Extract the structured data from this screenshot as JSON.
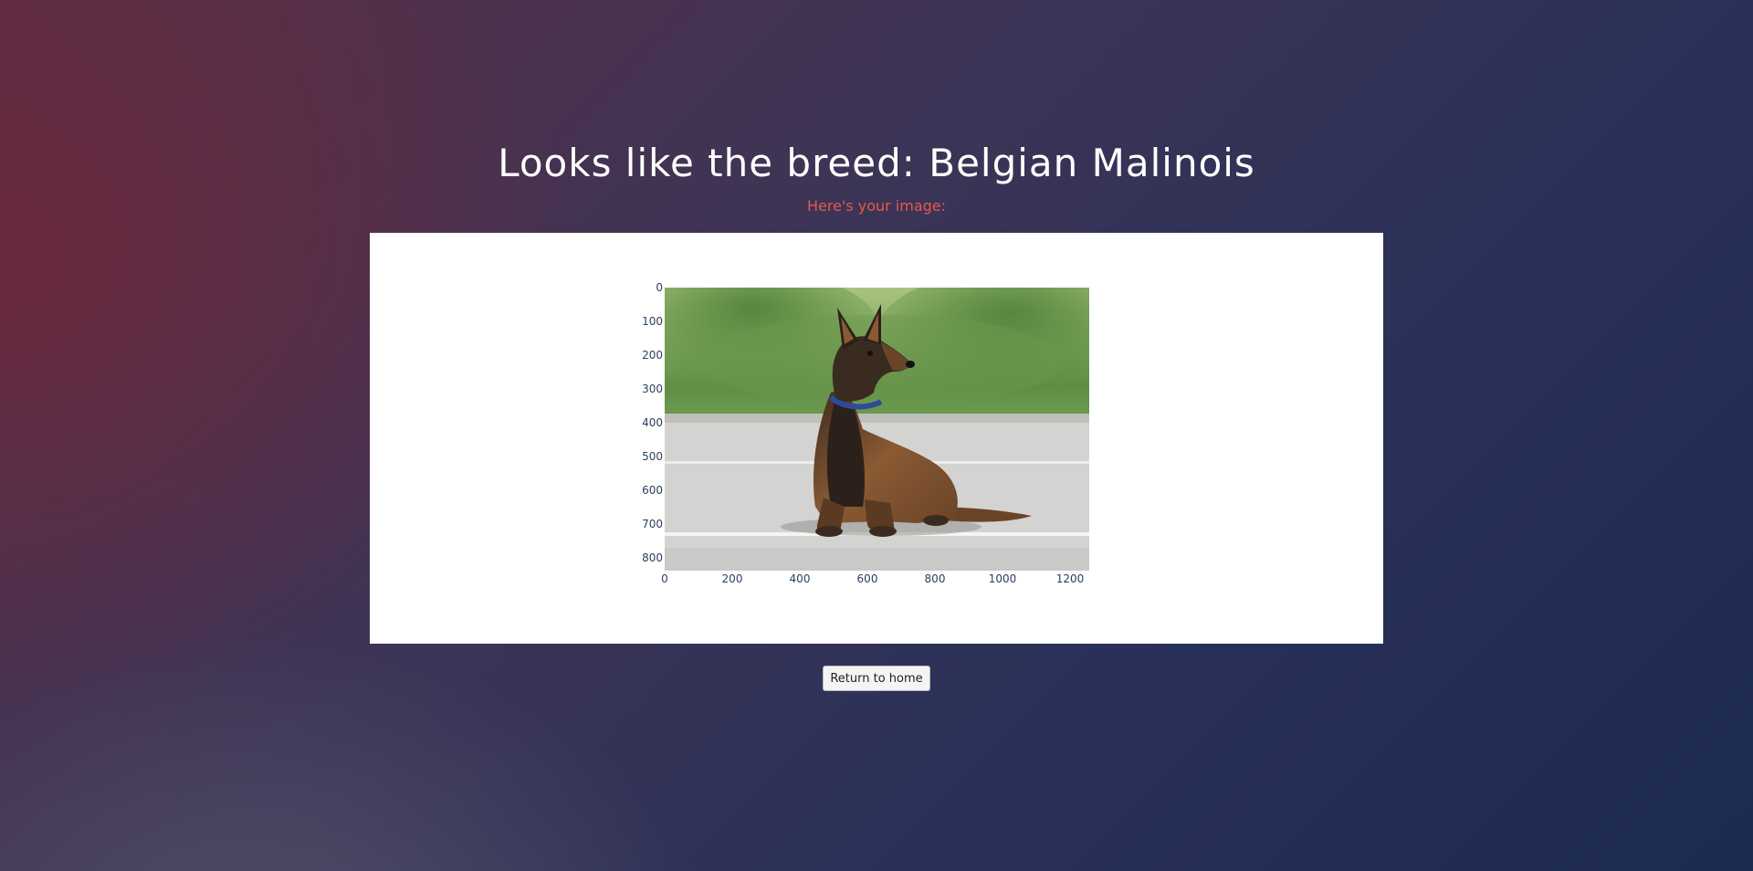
{
  "header": {
    "title": "Looks like the breed: Belgian Malinois",
    "subtitle": "Here's your image:"
  },
  "plot": {
    "image_description_icon": "dog-photo",
    "x_ticks": [
      "0",
      "200",
      "400",
      "600",
      "800",
      "1000",
      "1200"
    ],
    "y_ticks": [
      "0",
      "100",
      "200",
      "300",
      "400",
      "500",
      "600",
      "700",
      "800"
    ],
    "x_range": [
      0,
      1250
    ],
    "y_range": [
      0,
      833
    ]
  },
  "actions": {
    "return_label": "Return to home"
  },
  "colors": {
    "title": "#ffffff",
    "subtitle": "#e9574f",
    "tick": "#2a3f5f",
    "panel": "#ffffff"
  }
}
